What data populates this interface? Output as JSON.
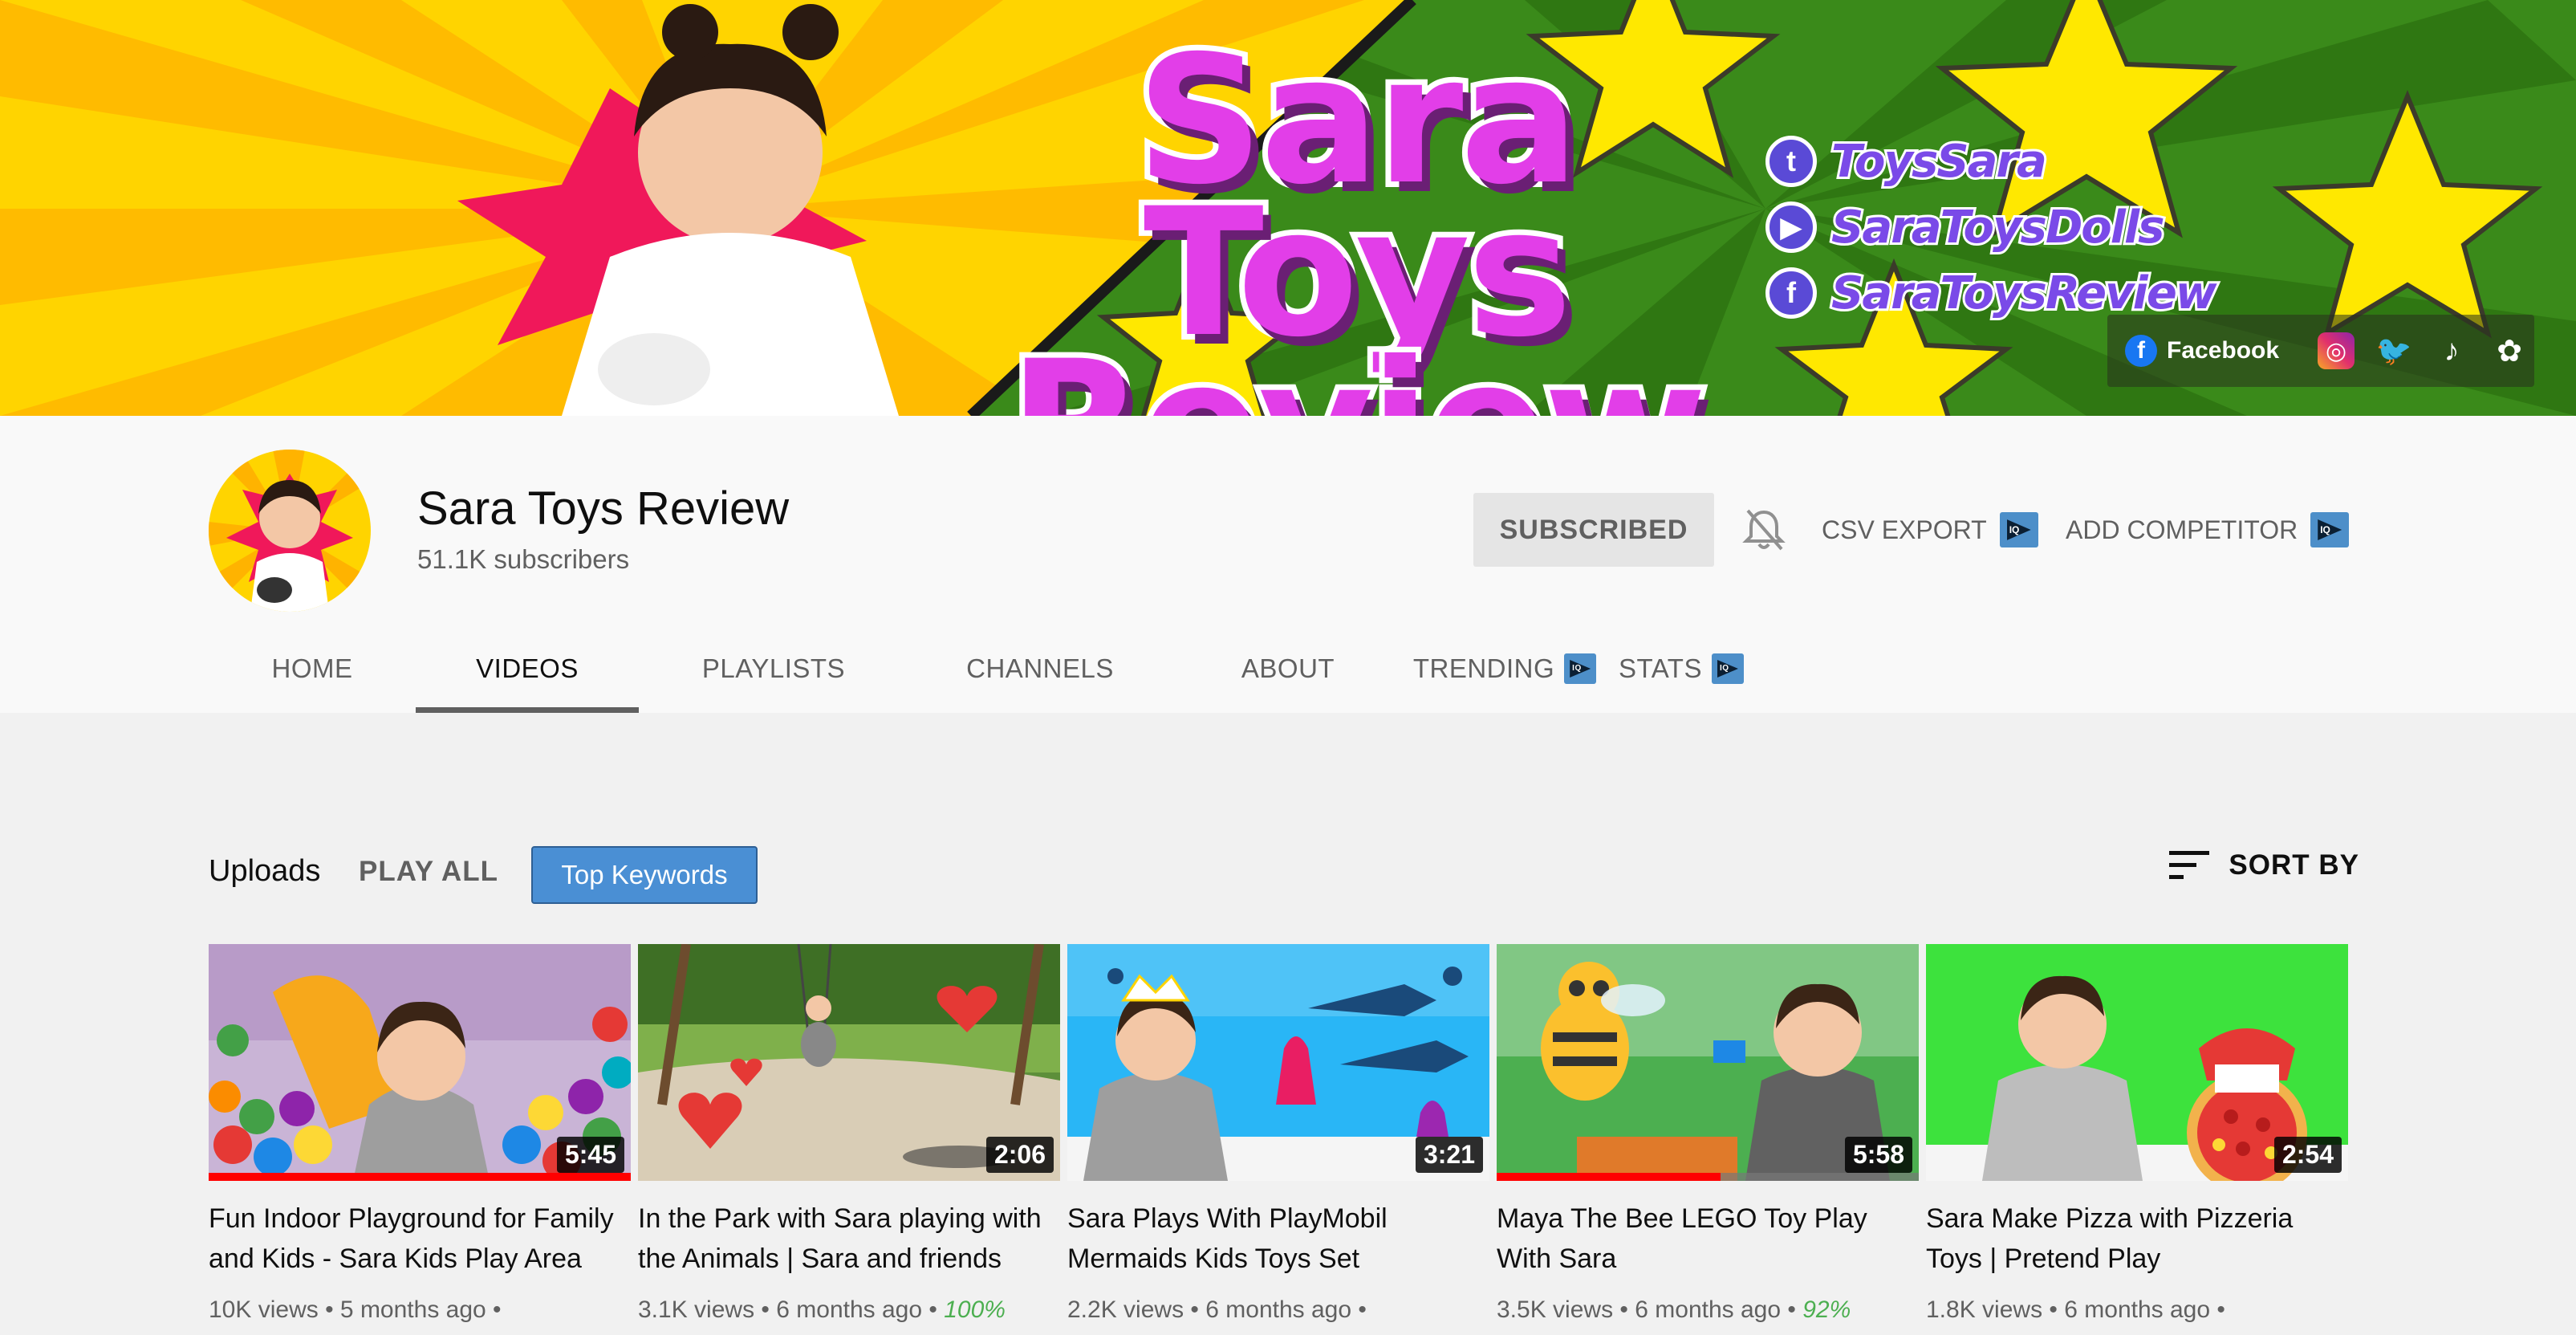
{
  "banner": {
    "title": "Sara Toys Review",
    "socials": [
      {
        "icon": "twitter-icon",
        "handle": "ToysSara"
      },
      {
        "icon": "youtube-icon",
        "handle": "SaraToysDolls"
      },
      {
        "icon": "facebook-icon",
        "handle": "SaraToysReview"
      }
    ],
    "links": {
      "facebook_label": "Facebook",
      "icons": [
        "instagram-icon",
        "twitter-icon",
        "tiktok-icon",
        "other-link-icon"
      ]
    }
  },
  "channel": {
    "name": "Sara Toys Review",
    "subscribers": "51.1K subscribers",
    "subscribe_label": "SUBSCRIBED",
    "csv_export_label": "CSV EXPORT",
    "add_competitor_label": "ADD COMPETITOR"
  },
  "tabs": [
    {
      "label": "HOME",
      "active": false
    },
    {
      "label": "VIDEOS",
      "active": true
    },
    {
      "label": "PLAYLISTS",
      "active": false
    },
    {
      "label": "CHANNELS",
      "active": false
    },
    {
      "label": "ABOUT",
      "active": false
    },
    {
      "label": "TRENDING",
      "active": false,
      "badge": true
    },
    {
      "label": "STATS",
      "active": false,
      "badge": true
    }
  ],
  "uploads": {
    "title": "Uploads",
    "play_all": "PLAY ALL",
    "top_keywords": "Top Keywords",
    "sort_by": "SORT BY"
  },
  "videos": [
    {
      "title": "Fun Indoor Playground for Family and Kids - Sara Kids Play Area",
      "duration": "5:45",
      "views": "10K views",
      "age": "5 months ago",
      "pct": "",
      "watched": 1.0
    },
    {
      "title": "In the Park with Sara playing with the Animals | Sara and friends",
      "duration": "2:06",
      "views": "3.1K views",
      "age": "6 months ago",
      "pct": "100%",
      "watched": 0
    },
    {
      "title": "Sara Plays With PlayMobil Mermaids Kids Toys Set",
      "duration": "3:21",
      "views": "2.2K views",
      "age": "6 months ago",
      "pct": "",
      "watched": 0
    },
    {
      "title": "Maya The Bee LEGO Toy Play With Sara",
      "duration": "5:58",
      "views": "3.5K views",
      "age": "6 months ago",
      "pct": "92%",
      "watched": 0.53
    },
    {
      "title": "Sara Make Pizza with Pizzeria Toys | Pretend Play",
      "duration": "2:54",
      "views": "1.8K views",
      "age": "6 months ago",
      "pct": "",
      "watched": 0
    }
  ],
  "colors": {
    "accent_blue": "#4a8fd4",
    "progress_red": "#ff0000",
    "percent_green": "#4caf50"
  }
}
